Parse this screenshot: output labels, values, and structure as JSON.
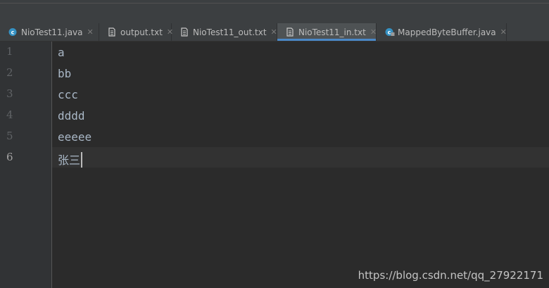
{
  "tabs": [
    {
      "label": "NioTest11.java",
      "icon": "java-class-icon"
    },
    {
      "label": "output.txt",
      "icon": "text-file-icon"
    },
    {
      "label": "NioTest11_out.txt",
      "icon": "text-file-icon"
    },
    {
      "label": "NioTest11_in.txt",
      "icon": "text-file-icon",
      "active": true
    },
    {
      "label": "MappedByteBuffer.java",
      "icon": "java-class-locked-icon"
    }
  ],
  "close_glyph": "✕",
  "editor": {
    "lines": [
      {
        "number": "1",
        "text": "a"
      },
      {
        "number": "2",
        "text": "bb"
      },
      {
        "number": "3",
        "text": "ccc"
      },
      {
        "number": "4",
        "text": "dddd"
      },
      {
        "number": "5",
        "text": "eeeee"
      },
      {
        "number": "6",
        "text": "张三"
      }
    ],
    "current_line": 6
  },
  "watermark": "https://blog.csdn.net/qq_27922171",
  "colors": {
    "background": "#2b2b2b",
    "gutter": "#313335",
    "tab_accent": "#4a88c7",
    "text": "#a9b7c6"
  }
}
